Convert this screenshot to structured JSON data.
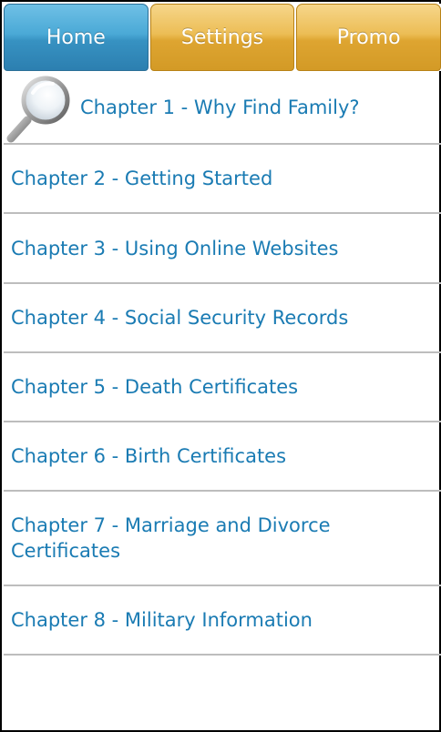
{
  "tabs": [
    {
      "label": "Home",
      "active": true
    },
    {
      "label": "Settings",
      "active": false
    },
    {
      "label": "Promo",
      "active": false
    }
  ],
  "chapters": [
    {
      "label": "Chapter 1 - Why Find Family?",
      "icon": "magnifying-glass-icon"
    },
    {
      "label": "Chapter 2 - Getting Started"
    },
    {
      "label": "Chapter 3 - Using Online Websites"
    },
    {
      "label": "Chapter 4 - Social Security Records"
    },
    {
      "label": "Chapter 5 - Death Certificates"
    },
    {
      "label": "Chapter 6 - Birth Certificates"
    },
    {
      "label": "Chapter 7 - Marriage and Divorce Certificates"
    },
    {
      "label": "Chapter 8 - Military Information"
    }
  ],
  "colors": {
    "active_tab": "#3792c2",
    "inactive_tab": "#dea531",
    "link_text": "#1a7bb3",
    "divider": "#bdbdbd"
  }
}
